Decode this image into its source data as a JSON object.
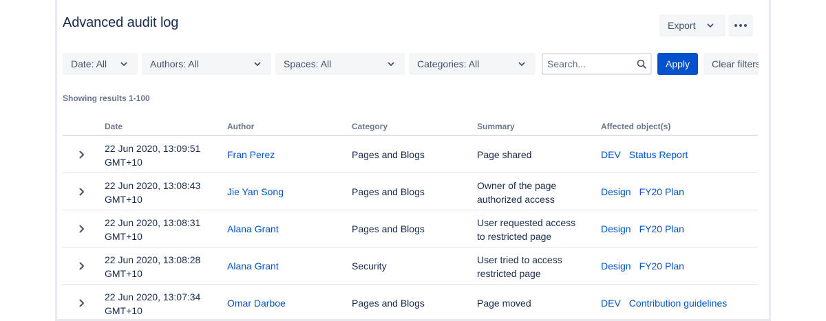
{
  "header": {
    "title": "Advanced audit log",
    "export_label": "Export"
  },
  "filters": {
    "date": "Date: All",
    "authors": "Authors: All",
    "spaces": "Spaces: All",
    "categories": "Categories: All",
    "search_placeholder": "Search...",
    "apply_label": "Apply",
    "clear_label": "Clear filters"
  },
  "results_text": "Showing results 1-100",
  "table": {
    "columns": [
      "Date",
      "Author",
      "Category",
      "Summary",
      "Affected object(s)"
    ],
    "rows": [
      {
        "date_line1": "22 Jun 2020, 13:09:51",
        "date_line2": "GMT+10",
        "author": "Fran Perez",
        "category": "Pages and Blogs",
        "summary_line1": "Page shared",
        "summary_line2": "",
        "affected": [
          "DEV",
          "Status Report"
        ]
      },
      {
        "date_line1": "22 Jun 2020, 13:08:43",
        "date_line2": "GMT+10",
        "author": "Jie Yan Song",
        "category": "Pages and Blogs",
        "summary_line1": "Owner of the page",
        "summary_line2": "authorized access",
        "affected": [
          "Design",
          "FY20 Plan"
        ]
      },
      {
        "date_line1": "22 Jun 2020, 13:08:31",
        "date_line2": "GMT+10",
        "author": "Alana Grant",
        "category": "Pages and Blogs",
        "summary_line1": "User requested access",
        "summary_line2": "to restricted page",
        "affected": [
          "Design",
          "FY20 Plan"
        ]
      },
      {
        "date_line1": "22 Jun 2020, 13:08:28",
        "date_line2": "GMT+10",
        "author": "Alana Grant",
        "category": "Security",
        "summary_line1": "User tried to access",
        "summary_line2": "restricted page",
        "affected": [
          "Design",
          "FY20 Plan"
        ]
      },
      {
        "date_line1": "22 Jun 2020, 13:07:34",
        "date_line2": "GMT+10",
        "author": "Omar Darboe",
        "category": "Pages and Blogs",
        "summary_line1": "Page moved",
        "summary_line2": "",
        "affected": [
          "DEV",
          "Contribution guidelines"
        ]
      }
    ]
  },
  "colors": {
    "primary": "#0052cc",
    "text": "#172b4d",
    "subtle": "#6b778c",
    "button_bg": "#f4f5f7",
    "border": "#dfe1e6"
  },
  "icons": [
    "chevron-down-icon",
    "more-icon",
    "search-icon",
    "chevron-right-icon"
  ]
}
